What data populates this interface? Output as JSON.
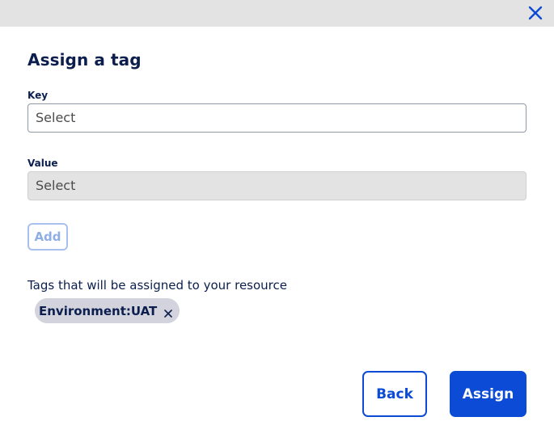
{
  "dialog": {
    "title": "Assign a tag",
    "close_icon": "close-icon"
  },
  "form": {
    "key_label": "Key",
    "key_value": "Select",
    "value_label": "Value",
    "value_value": "Select",
    "add_label": "Add"
  },
  "tags": {
    "label": "Tags that will be assigned to your resource",
    "items": [
      {
        "text": "Environment:UAT",
        "remove_icon": "close-icon"
      }
    ]
  },
  "footer": {
    "back_label": "Back",
    "assign_label": "Assign"
  },
  "colors": {
    "primary": "#0b4bd5",
    "text_dark": "#0b1e4e",
    "header_bg": "#e3e3e3",
    "chip_bg": "#d3d3dd"
  }
}
